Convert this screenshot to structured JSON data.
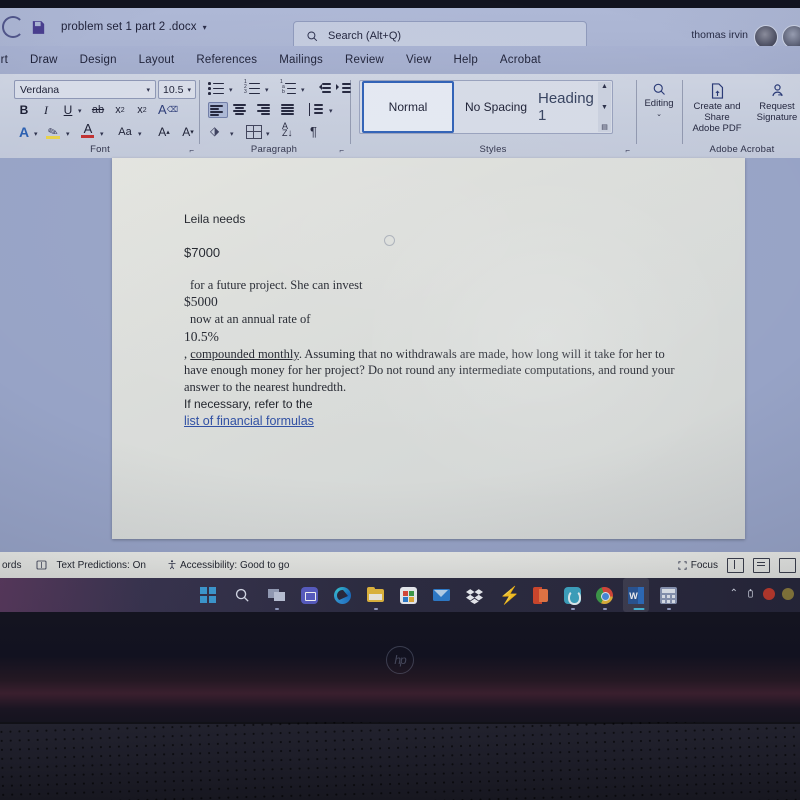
{
  "titlebar": {
    "autosave_icon": "autosave-toggle-icon",
    "save_icon": "save-icon",
    "filename": "problem set 1 part 2 .docx",
    "filename_caret": "▾",
    "user_name": "thomas irvin"
  },
  "search": {
    "icon": "search-icon",
    "placeholder": "Search (Alt+Q)"
  },
  "tabs": [
    {
      "label": "ert",
      "name": "tab-insert"
    },
    {
      "label": "Draw",
      "name": "tab-draw"
    },
    {
      "label": "Design",
      "name": "tab-design"
    },
    {
      "label": "Layout",
      "name": "tab-layout"
    },
    {
      "label": "References",
      "name": "tab-references"
    },
    {
      "label": "Mailings",
      "name": "tab-mailings"
    },
    {
      "label": "Review",
      "name": "tab-review"
    },
    {
      "label": "View",
      "name": "tab-view"
    },
    {
      "label": "Help",
      "name": "tab-help"
    },
    {
      "label": "Acrobat",
      "name": "tab-acrobat"
    }
  ],
  "ribbon": {
    "font_group": {
      "label": "Font",
      "font_name": "Verdana",
      "font_size": "10.5",
      "bold": "B",
      "italic": "I",
      "underline": "U",
      "strikethrough": "ab",
      "subscript": "x",
      "superscript": "x",
      "clear_formatting": "A",
      "text_effects": "A",
      "highlight": "A",
      "font_color": "A",
      "change_case": "Aa",
      "grow_font": "A",
      "shrink_font": "A"
    },
    "paragraph_group": {
      "label": "Paragraph"
    },
    "styles_group": {
      "label": "Styles",
      "items": [
        {
          "label": "Normal",
          "selected": true
        },
        {
          "label": "No Spacing",
          "selected": false
        },
        {
          "label": "Heading 1",
          "selected": false
        }
      ]
    },
    "editing_group": {
      "label": "Editing",
      "icon": "search-icon",
      "caret": "⌄"
    },
    "acrobat_group": {
      "label": "Adobe Acrobat",
      "create_share_line1": "Create and Share",
      "create_share_line2": "Adobe PDF",
      "request_sig_line1": "Request",
      "request_sig_line2": "Signature"
    }
  },
  "document": {
    "lines": [
      {
        "text": "Leila needs",
        "style": "sans"
      },
      {
        "text": "$7000",
        "style": "sans-bold"
      },
      {
        "text": "for a future project. She can invest",
        "style": "serif-indent"
      },
      {
        "text": "$5000",
        "style": "serif"
      },
      {
        "text": "now at an annual rate of",
        "style": "serif-indent"
      },
      {
        "text": "10.5%",
        "style": "serif"
      },
      {
        "text": ", compounded monthly. Assuming that no withdrawals are made, how long will it take for her to have enough money for her project? Do not round any intermediate computations, and round your answer to the nearest hundredth.",
        "style": "serif-underlined-lead"
      },
      {
        "text": "If necessary, refer to the",
        "style": "sans"
      },
      {
        "text": "list of financial formulas",
        "style": "link"
      }
    ],
    "underlined_phrase": "compounded monthly",
    "link_text": "list of financial formulas"
  },
  "statusbar": {
    "word_count": "ords",
    "text_predictions": "Text Predictions: On",
    "accessibility": "Accessibility: Good to go",
    "focus": "Focus",
    "accessibility_icon": "accessibility-icon",
    "predictions_icon": "text-predictions-icon",
    "focus_icon": "focus-icon",
    "view_read_icon": "read-mode-icon",
    "view_print_icon": "print-layout-icon",
    "view_web_icon": "web-layout-icon"
  },
  "taskbar": {
    "icons": [
      {
        "name": "start-icon",
        "label": "Start"
      },
      {
        "name": "search-icon",
        "label": "Search"
      },
      {
        "name": "task-view-icon",
        "label": "Task View"
      },
      {
        "name": "teams-icon",
        "label": "Microsoft Teams"
      },
      {
        "name": "edge-icon",
        "label": "Microsoft Edge"
      },
      {
        "name": "file-explorer-icon",
        "label": "File Explorer"
      },
      {
        "name": "microsoft-store-icon",
        "label": "Microsoft Store"
      },
      {
        "name": "mail-icon",
        "label": "Mail"
      },
      {
        "name": "dropbox-icon",
        "label": "Dropbox"
      },
      {
        "name": "lightning-icon",
        "label": "Lightning"
      },
      {
        "name": "office-icon",
        "label": "Microsoft Office"
      },
      {
        "name": "app-teal-icon",
        "label": "App"
      },
      {
        "name": "chrome-icon",
        "label": "Google Chrome"
      },
      {
        "name": "word-icon",
        "label": "Microsoft Word"
      },
      {
        "name": "calculator-icon",
        "label": "Calculator"
      }
    ],
    "tray": {
      "chevron": "⌃",
      "usb_icon": "usb-icon",
      "notification_icon": "notification-icon",
      "shield_icon": "shield-icon"
    }
  },
  "laptop": {
    "brand": "hp"
  },
  "colors": {
    "ribbon_blue": "#aeb8d6",
    "page_bg": "#e3e4df",
    "link_blue": "#2f4fa3",
    "accent_blue": "#2d5fb5",
    "taskbar_bg": "#2b2a3e"
  }
}
